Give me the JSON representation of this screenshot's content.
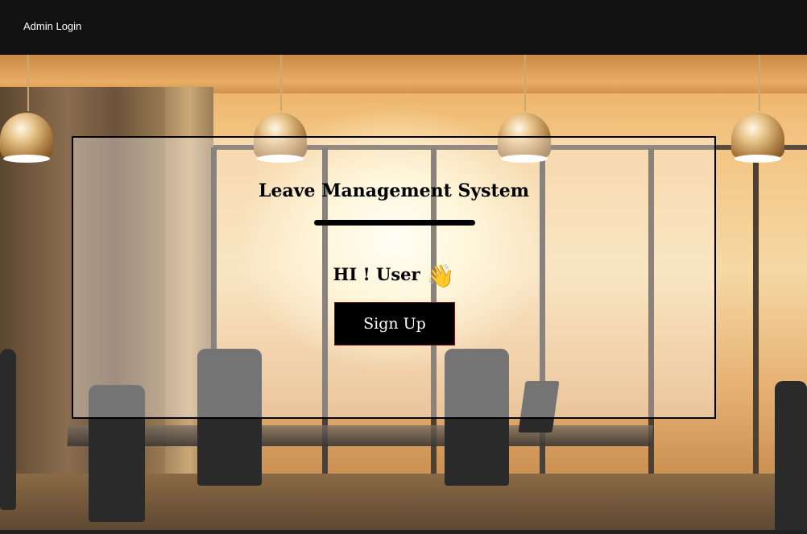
{
  "nav": {
    "admin_login": "Admin Login"
  },
  "card": {
    "title": "Leave Management System",
    "greeting": "HI ! User",
    "wave_icon": "👋",
    "signup_label": "Sign Up"
  },
  "colors": {
    "navbar": "#111111",
    "button_bg": "#000000",
    "button_text": "#ffffff",
    "accent_divider": "#000000"
  },
  "icons": {
    "greeting": "waving-hand-icon"
  }
}
